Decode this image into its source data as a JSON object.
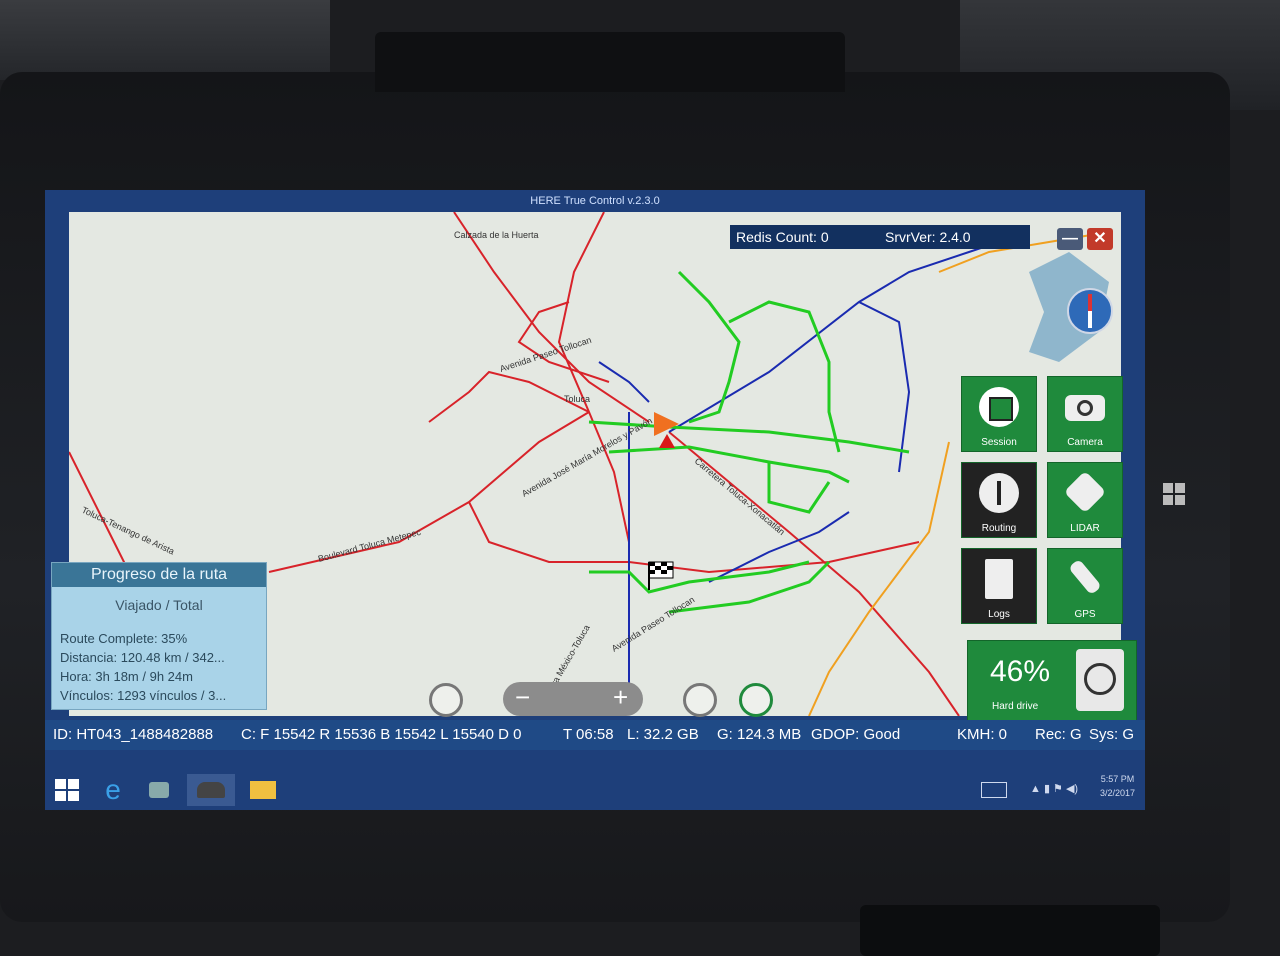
{
  "app": {
    "title": "HERE True Control v.2.3.0"
  },
  "topbar": {
    "redis_count": "Redis Count: 0",
    "server_version": "SrvrVer: 2.4.0",
    "minimize_label": "—",
    "close_label": "✕"
  },
  "map": {
    "road_labels": {
      "calzada": "Calzada de la Huerta",
      "paseo_tollocan_n": "Avenida Paseo Tollocan",
      "toluca": "Toluca",
      "morelos": "Avenida José María Morelos y Pavón",
      "xonacatlan": "Carretera Toluca-Xonacatlán",
      "tenango": "Toluca-Tenango de Arista",
      "metepec": "Boulevard Toluca Metepec",
      "paseo_tollocan_s": "Avenida Paseo Tollocan",
      "mexico_toluca": "Carretera México-Toluca"
    },
    "colors": {
      "land": "#e4e8e2",
      "highway_red": "#d8232a",
      "road_blue": "#1a2bb0",
      "route_green": "#22cc22",
      "orange": "#f0a020",
      "water": "#8fb6cc"
    }
  },
  "tiles": [
    {
      "label": "Session",
      "icon": "square-stop-icon"
    },
    {
      "label": "Camera",
      "icon": "camera-icon"
    },
    {
      "label": "Routing",
      "icon": "routing-sign-icon"
    },
    {
      "label": "LIDAR",
      "icon": "lidar-icon"
    },
    {
      "label": "Logs",
      "icon": "document-icon"
    },
    {
      "label": "GPS",
      "icon": "satellite-icon"
    }
  ],
  "hard_drive": {
    "percent": "46%",
    "label": "Hard drive"
  },
  "progress_panel": {
    "title": "Progreso de la ruta",
    "subtitle": "Viajado / Total",
    "route_complete": "Route Complete: 35%",
    "distance": "Distancia: 120.48 km / 342...",
    "time": "Hora: 3h 18m / 9h 24m",
    "links": "Vínculos: 1293 vínculos / 3..."
  },
  "zoom": {
    "minus": "−",
    "plus": "+"
  },
  "status": {
    "id": "ID: HT043_1488482888",
    "counts": "C: F 15542 R 15536 B 15542 L 15540 D 0",
    "time": "T 06:58",
    "local_storage": "L:  32.2 GB",
    "gps_storage": "G: 124.3 MB",
    "gdop": "GDOP: Good",
    "kmh": "KMH: 0",
    "rec": "Rec: G",
    "sys": "Sys: G"
  },
  "taskbar": {
    "clock_time": "5:57 PM",
    "clock_date": "3/2/2017"
  }
}
